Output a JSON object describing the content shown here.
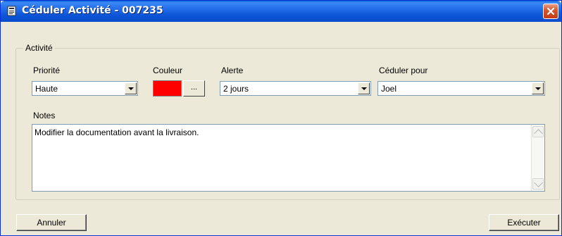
{
  "window": {
    "title": "Céduler Activité - 007235"
  },
  "group": {
    "label": "Activité"
  },
  "priority": {
    "label": "Priorité",
    "value": "Haute"
  },
  "color": {
    "label": "Couleur",
    "value": "#ff0000",
    "picker_label": "..."
  },
  "alert": {
    "label": "Alerte",
    "value": "2 jours"
  },
  "schedule_for": {
    "label": "Céduler pour",
    "value": "Joel"
  },
  "notes": {
    "label": "Notes",
    "value": "Modifier la documentation avant la livraison."
  },
  "buttons": {
    "cancel": "Annuler",
    "execute": "Exécuter"
  }
}
